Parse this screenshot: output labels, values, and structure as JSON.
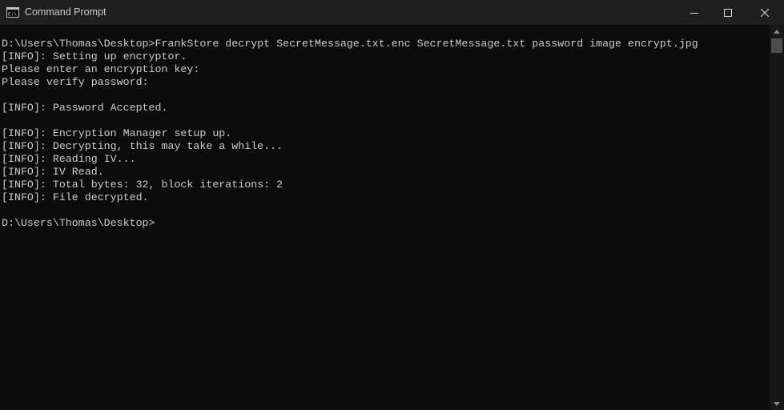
{
  "window": {
    "title": "Command Prompt",
    "app_icon": "cmd-icon",
    "controls": {
      "minimize_icon": "minimize-icon",
      "maximize_icon": "maximize-icon",
      "close_icon": "close-icon"
    }
  },
  "console": {
    "background": "#0c0c0c",
    "text_color": "#cccccc",
    "lines": [
      "D:\\Users\\Thomas\\Desktop>FrankStore decrypt SecretMessage.txt.enc SecretMessage.txt password image encrypt.jpg",
      "[INFO]: Setting up encryptor.",
      "Please enter an encryption key:",
      "Please verify password:",
      "",
      "[INFO]: Password Accepted.",
      "",
      "[INFO]: Encryption Manager setup up.",
      "[INFO]: Decrypting, this may take a while...",
      "[INFO]: Reading IV...",
      "[INFO]: IV Read.",
      "[INFO]: Total bytes: 32, block iterations: 2",
      "[INFO]: File decrypted.",
      "",
      "D:\\Users\\Thomas\\Desktop>"
    ]
  },
  "scrollbar": {
    "up_icon": "scroll-up-arrow-icon",
    "down_icon": "scroll-down-arrow-icon"
  }
}
